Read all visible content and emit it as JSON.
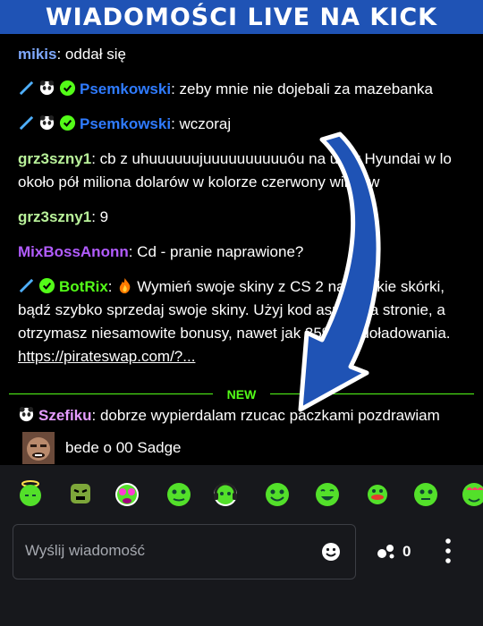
{
  "banner": {
    "title": "WIADOMOŚCI LIVE NA KICK"
  },
  "messages": [
    {
      "user": "mikis",
      "text": ": oddał się",
      "color": "#7fa9ff"
    },
    {
      "user": "Psemkowski",
      "text": ": zeby mnie nie dojebali za mazebanka",
      "color": "#2f7bff"
    },
    {
      "user": "Psemkowski",
      "text": ": wczoraj",
      "color": "#2f7bff"
    },
    {
      "user": "grz3szny1",
      "text": ": cb z uhuuuuuujuuuuuuuuuuóu na ulicy Hyundai w lo około pół miliona dolarów w kolorze czerwony winie w",
      "color": "#b9f29a"
    },
    {
      "user": "grz3szny1",
      "text": ": 9",
      "color": "#b9f29a"
    },
    {
      "user": "MixBossAnonn",
      "text": ": Cd - pranie naprawione?",
      "color": "#b25cff"
    },
    {
      "user": "BotRix",
      "text_pre": ": ",
      "text": "Wymień swoje skiny z CS 2 na epickie skórki, bądź szybko sprzedaj swoje skiny. Użyj kod aspen na stronie, a otrzymasz niesamowite bonusy, nawet jak 35% do doładowania. ",
      "link": "https://pirateswap.com/?...",
      "color": "#53fc18"
    },
    {
      "user": "Szefiku",
      "text": ": dobrze wypierdalam rzucac paczkami pozdrawiam",
      "text2": "bede o 00 Sadge",
      "color": "#e59cff"
    }
  ],
  "separator": {
    "label": "NEW",
    "color": "#53fc18"
  },
  "emotes": [
    "angel-emote",
    "angry-emote",
    "party-emote",
    "pepe-emote",
    "headset-emote",
    "smile-emote",
    "grin-emote",
    "duck-emote",
    "frog-emote",
    "heart-eyes-emote"
  ],
  "input": {
    "placeholder": "Wyślij wiadomość"
  },
  "points": {
    "value": "0"
  },
  "colors": {
    "banner": "#1f53b5",
    "kick_green": "#53fc18",
    "panel": "#17181c"
  }
}
